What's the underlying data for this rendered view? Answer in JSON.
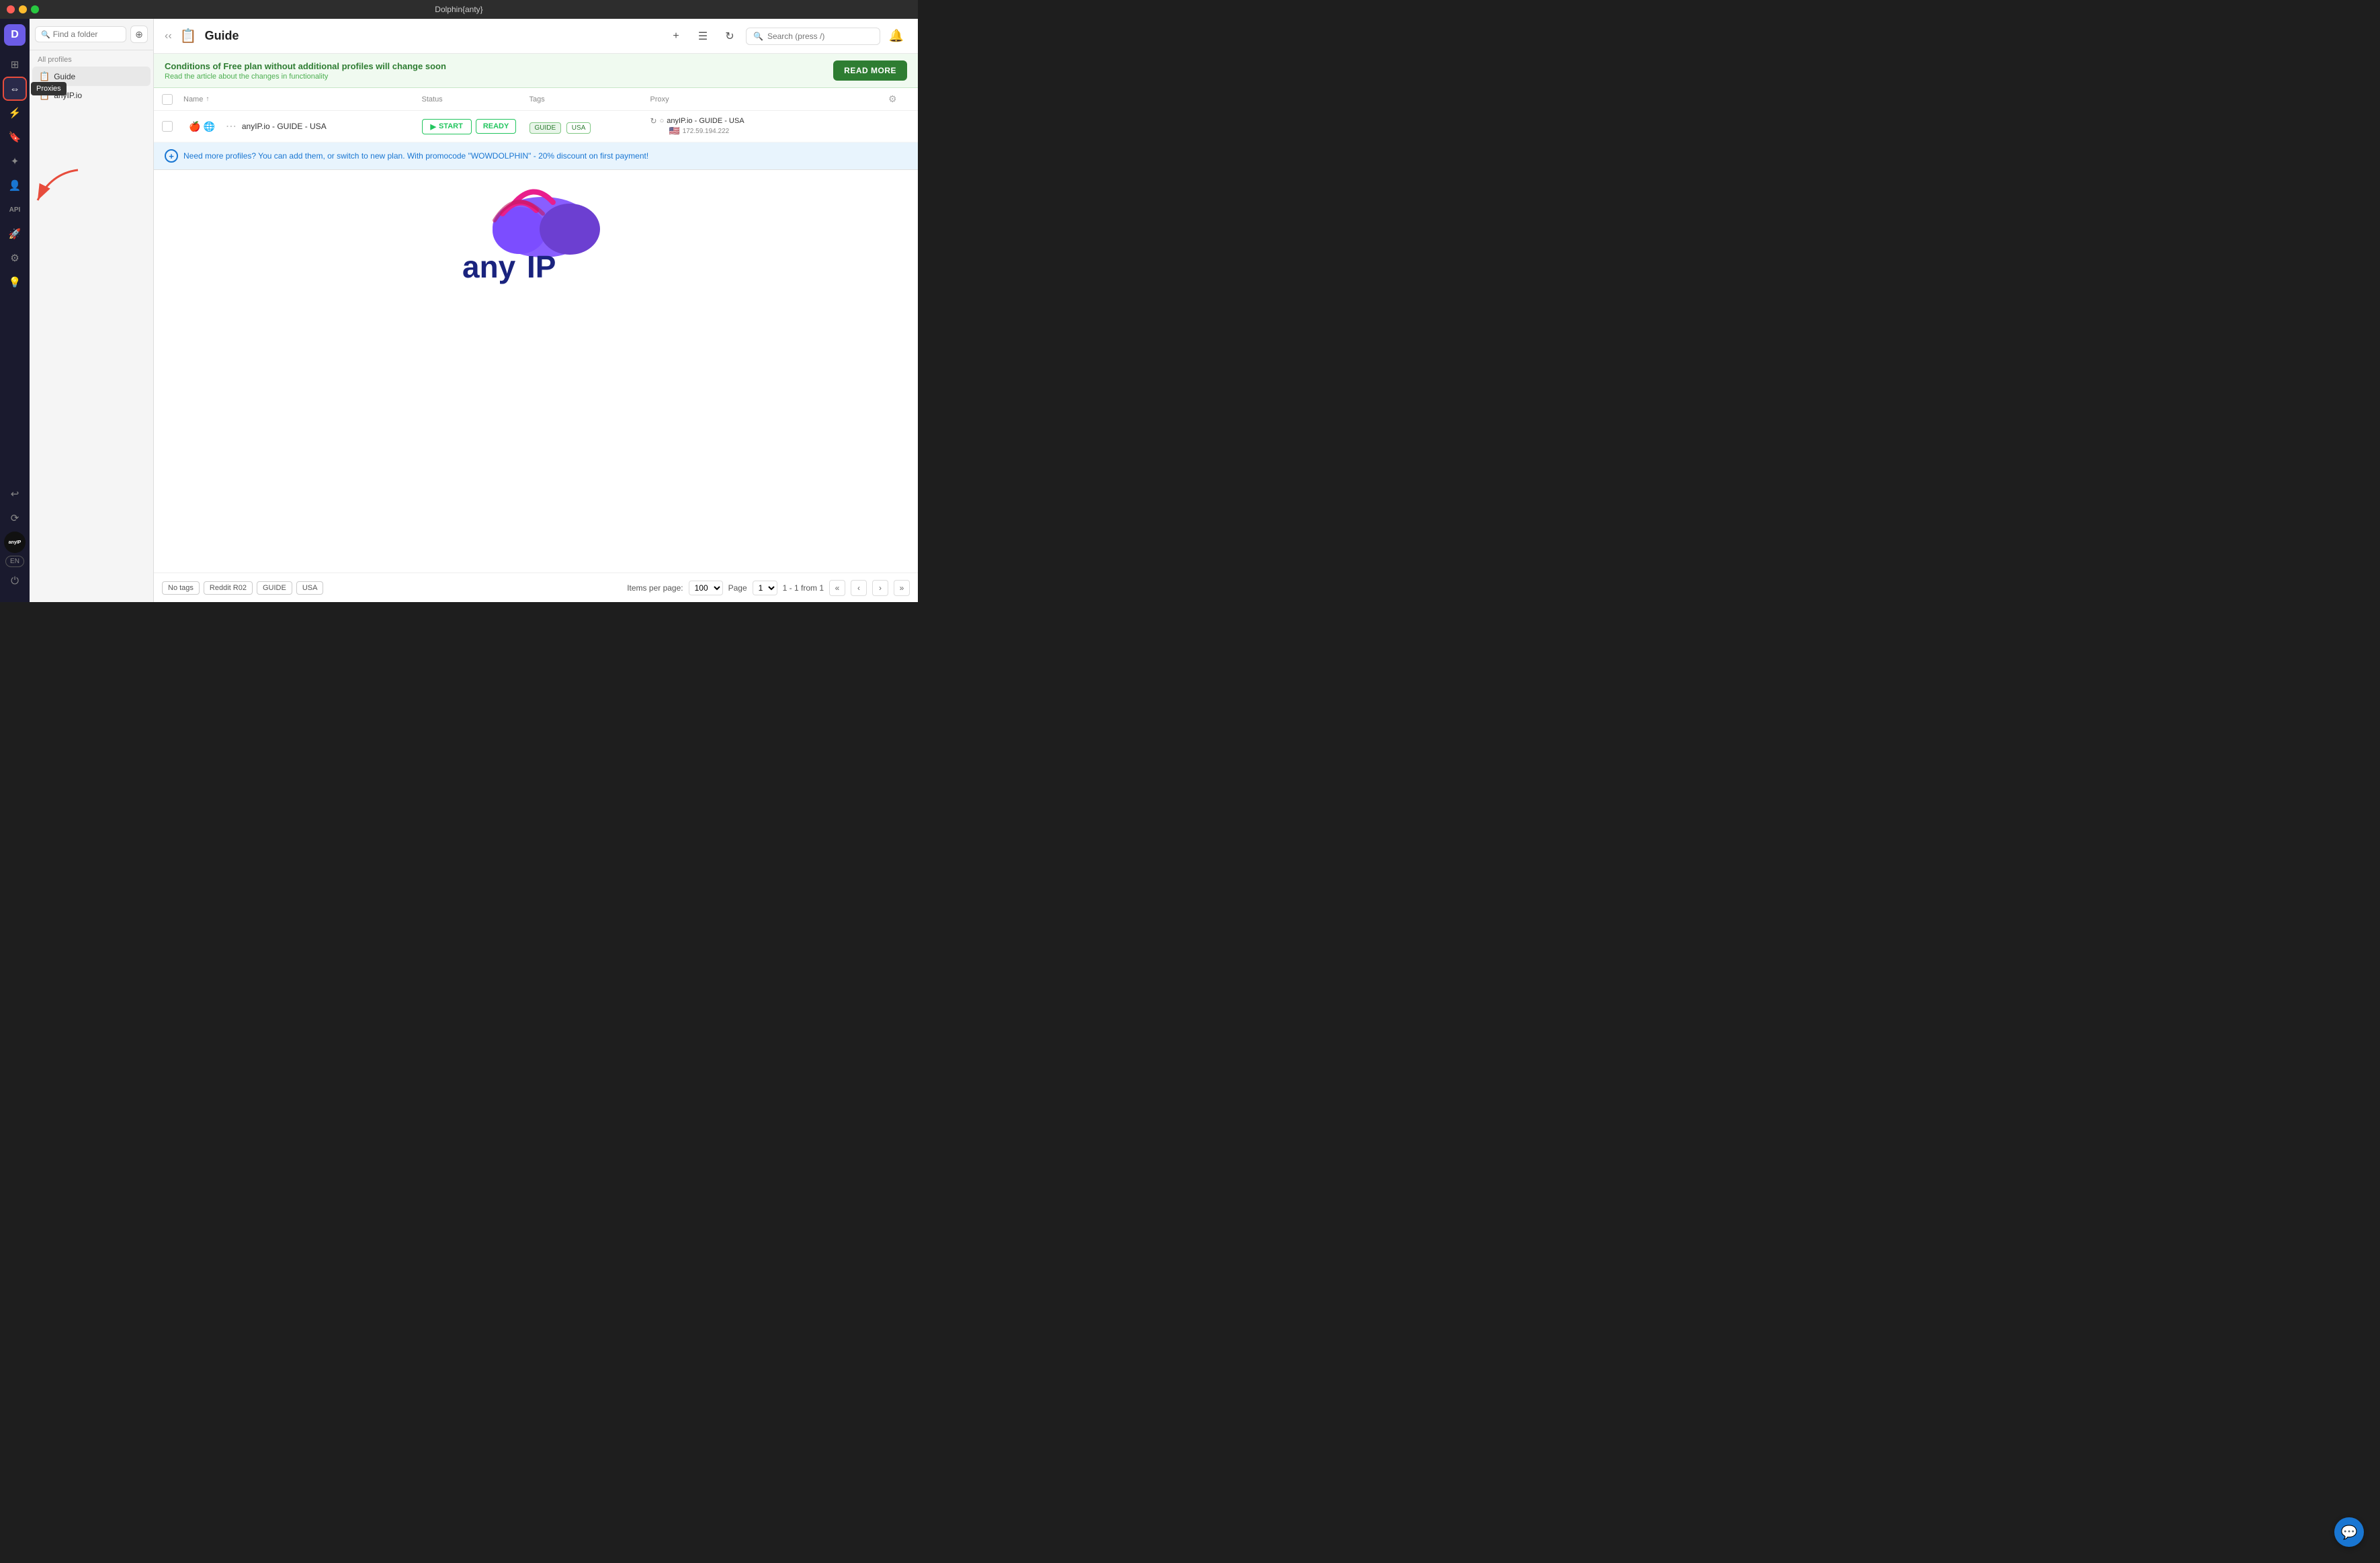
{
  "app": {
    "title": "Dolphin{anty}",
    "logo_letter": "D"
  },
  "titlebar": {
    "title": "Dolphin{anty}"
  },
  "sidebar": {
    "search_placeholder": "Find a folder",
    "section_title": "All profiles",
    "items": [
      {
        "id": "guide",
        "label": "Guide",
        "icon": "📋",
        "active": true
      },
      {
        "id": "anyip",
        "label": "anyIP.io",
        "icon": "📋"
      }
    ]
  },
  "header": {
    "page_title": "Guide",
    "page_icon": "📋",
    "search_placeholder": "Search (press /)",
    "add_label": "+",
    "filter_label": "≡",
    "refresh_label": "↻"
  },
  "banner": {
    "title": "Conditions of Free plan without additional profiles will change soon",
    "subtitle": "Read the article about the changes in functionality",
    "button_label": "READ MORE"
  },
  "table": {
    "columns": {
      "name": "Name",
      "status": "Status",
      "tags": "Tags",
      "proxy": "Proxy"
    },
    "rows": [
      {
        "id": 1,
        "name": "anyIP.io - GUIDE - USA",
        "icons": [
          "🍎",
          "🌐"
        ],
        "status_start": "START",
        "status_ready": "READY",
        "tags": [
          "GUIDE",
          "USA"
        ],
        "proxy_name": "anyIP.io - GUIDE - USA",
        "proxy_ip": "172.59.194.222",
        "proxy_flag": "🇺🇸"
      }
    ]
  },
  "promo": {
    "text": "Need more profiles? You can add them, or switch to new plan. With promocode \"WOWDOLPHIN\" - 20% discount on first payment!"
  },
  "footer": {
    "tags": [
      "No tags",
      "Reddit R02",
      "GUIDE",
      "USA"
    ],
    "items_per_page_label": "Items per page:",
    "items_per_page_value": "100",
    "page_label": "Page",
    "page_value": "1",
    "pagination_info": "1 - 1 from 1"
  },
  "nav_icons": [
    {
      "id": "profiles",
      "icon": "⊞",
      "tooltip": ""
    },
    {
      "id": "proxies",
      "icon": "⇔",
      "tooltip": "Proxies",
      "active": true
    },
    {
      "id": "extensions",
      "icon": "⚡",
      "tooltip": ""
    },
    {
      "id": "bookmarks",
      "icon": "🔖",
      "tooltip": ""
    },
    {
      "id": "automations",
      "icon": "⚙",
      "tooltip": ""
    },
    {
      "id": "users",
      "icon": "👤",
      "tooltip": ""
    },
    {
      "id": "api",
      "icon": "API",
      "tooltip": ""
    },
    {
      "id": "launch",
      "icon": "🚀",
      "tooltip": ""
    },
    {
      "id": "settings2",
      "icon": "⚙",
      "tooltip": ""
    },
    {
      "id": "tips",
      "icon": "💡",
      "tooltip": ""
    },
    {
      "id": "logout",
      "icon": "↩",
      "tooltip": ""
    }
  ],
  "bottom_icons": [
    {
      "id": "sync",
      "icon": "⟳"
    },
    {
      "id": "anyip-logo",
      "icon": "anyIP"
    },
    {
      "id": "lang",
      "label": "EN"
    }
  ],
  "chat_button": {
    "icon": "💬"
  }
}
